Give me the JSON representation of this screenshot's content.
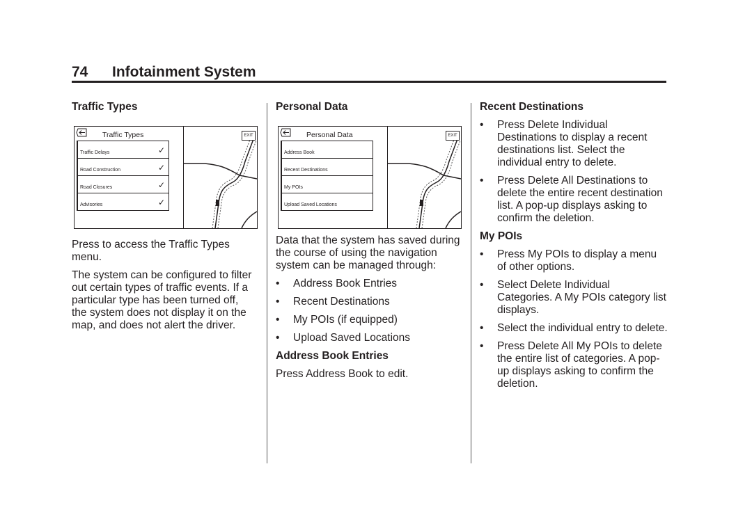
{
  "header": {
    "page_number": "74",
    "title": "Infotainment System"
  },
  "column1": {
    "heading": "Traffic Types",
    "screen": {
      "title": "Traffic Types",
      "exit_label": "EXIT",
      "items": [
        {
          "label": "Traffic Delays",
          "checked": "✓"
        },
        {
          "label": "Road Construction",
          "checked": "✓"
        },
        {
          "label": "Road Closures",
          "checked": "✓"
        },
        {
          "label": "Advisories",
          "checked": "✓"
        }
      ]
    },
    "paragraphs": [
      "Press to access the Traffic Types menu.",
      "The system can be configured to filter out certain types of traffic events. If a particular type has been turned off, the system does not display it on the map, and does not alert the driver."
    ]
  },
  "column2": {
    "heading": "Personal Data",
    "screen": {
      "title": "Personal Data",
      "exit_label": "EXIT",
      "items": [
        {
          "label": "Address Book"
        },
        {
          "label": "Recent Destinations"
        },
        {
          "label": "My POIs"
        },
        {
          "label": "Upload Saved Locations"
        }
      ]
    },
    "intro": "Data that the system has saved during the course of using the navigation system can be managed through:",
    "bullets": [
      "Address Book Entries",
      "Recent Destinations",
      "My POIs (if equipped)",
      "Upload Saved Locations"
    ],
    "subheading": "Address Book Entries",
    "sub_text": "Press Address Book to edit."
  },
  "column3": {
    "heading1": "Recent Destinations",
    "bullets1": [
      "Press Delete Individual Destinations to display a recent destinations list. Select the individual entry to delete.",
      "Press Delete All Destinations to delete the entire recent destination list. A pop-up displays asking to confirm the deletion."
    ],
    "heading2": "My POIs",
    "bullets2": [
      "Press My POIs to display a menu of other options.",
      "Select Delete Individual Categories. A My POIs category list displays.",
      "Select the individual entry to delete.",
      "Press Delete All My POIs to delete the entire list of categories. A pop-up displays asking to confirm the deletion."
    ]
  },
  "bullet_char": "•"
}
